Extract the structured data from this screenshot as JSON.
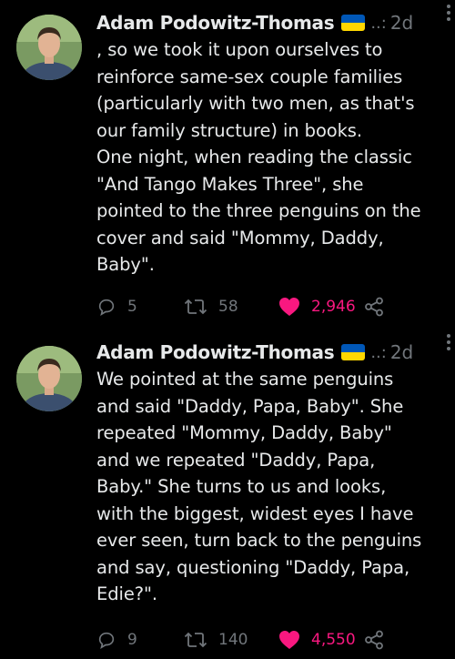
{
  "tweets": [
    {
      "author": "Adam Podowitz-Thomas",
      "dots": "..:",
      "time": "2d",
      "text": ", so we took it upon ourselves to\nreinforce same-sex couple families\n(particularly with two men, as that's\nour family structure) in books.\nOne night, when reading the classic\n\"And Tango Makes Three\", she\npointed to the three penguins on the\ncover and said \"Mommy, Daddy,\nBaby\".",
      "replies": "5",
      "retweets": "58",
      "likes": "2,946"
    },
    {
      "author": "Adam Podowitz-Thomas",
      "dots": "..:",
      "time": "2d",
      "text": "We pointed at the same penguins\nand said \"Daddy, Papa, Baby\". She\nrepeated \"Mommy, Daddy, Baby\"\nand we repeated \"Daddy, Papa,\nBaby.\"  She turns to us and looks,\nwith the biggest, widest eyes I have\never seen, turn back to the penguins\nand say, questioning \"Daddy, Papa,\nEdie?\".",
      "replies": "9",
      "retweets": "140",
      "likes": "4,550"
    }
  ],
  "colors": {
    "background": "#000000",
    "text": "#e7e9ea",
    "muted": "#71767b",
    "like": "#f91880",
    "flag_blue": "#0057b7",
    "flag_yellow": "#ffd700"
  },
  "icons": [
    "reply-icon",
    "retweet-icon",
    "heart-icon",
    "share-icon",
    "more-icon",
    "ukraine-flag-icon"
  ]
}
